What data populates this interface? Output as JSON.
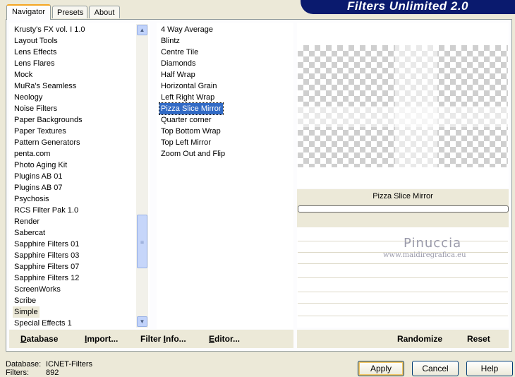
{
  "app_title": "Filters Unlimited 2.0",
  "tabs": [
    {
      "label": "Navigator",
      "active": true
    },
    {
      "label": "Presets",
      "active": false
    },
    {
      "label": "About",
      "active": false
    }
  ],
  "categories": {
    "items": [
      "Krusty's FX vol. I 1.0",
      "Layout Tools",
      "Lens Effects",
      "Lens Flares",
      "Mock",
      "MuRa's Seamless",
      "Neology",
      "Noise Filters",
      "Paper Backgrounds",
      "Paper Textures",
      "Pattern Generators",
      "penta.com",
      "Photo Aging Kit",
      "Plugins AB 01",
      "Plugins AB 07",
      "Psychosis",
      "RCS Filter Pak 1.0",
      "Render",
      "Sabercat",
      "Sapphire Filters 01",
      "Sapphire Filters 03",
      "Sapphire Filters 07",
      "Sapphire Filters 12",
      "ScreenWorks",
      "Scribe",
      "Simple",
      "Special Effects 1"
    ],
    "highlighted": "Simple"
  },
  "filters": {
    "items": [
      "4 Way Average",
      "Blintz",
      "Centre Tile",
      "Diamonds",
      "Half Wrap",
      "Horizontal Grain",
      "Left Right Wrap",
      "Pizza Slice Mirror",
      "Quarter corner",
      "Top Bottom Wrap",
      "Top Left Mirror",
      "Zoom Out and Flip"
    ],
    "selected": "Pizza Slice Mirror"
  },
  "preview": {
    "filter_name": "Pizza Slice Mirror",
    "progress": 0,
    "watermark_name": "Pinuccia",
    "watermark_url": "www.maidiregrafica.eu"
  },
  "bottom_links": {
    "database": {
      "u": "D",
      "rest": "atabase"
    },
    "import": {
      "u": "I",
      "rest": "mport..."
    },
    "filter_info": {
      "pre": "Filter ",
      "u": "I",
      "rest": "nfo..."
    },
    "editor": {
      "u": "E",
      "rest": "ditor..."
    },
    "randomize": "Randomize",
    "reset": "Reset"
  },
  "status": {
    "database_label": "Database:",
    "database_value": "ICNET-Filters",
    "filters_label": "Filters:",
    "filters_value": "892"
  },
  "buttons": {
    "apply": "Apply",
    "cancel": "Cancel",
    "help": "Help"
  },
  "colors": {
    "banner": "#0a1a6e",
    "selection": "#316ac5",
    "window": "#ece9d8"
  }
}
